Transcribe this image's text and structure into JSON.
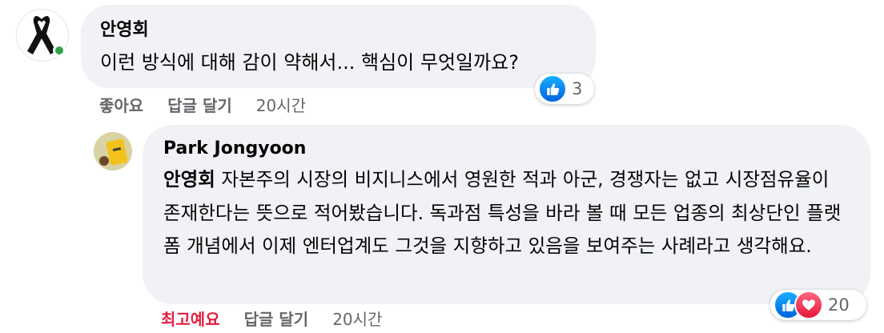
{
  "comment": {
    "author": "안영회",
    "text": "이런 방식에 대해 감이 약해서... 핵심이 무엇일까요?",
    "reactions": {
      "count": "3",
      "icons": [
        "like-icon"
      ]
    },
    "actions": {
      "like": "좋아요",
      "reply": "답글 달기",
      "time": "20시간"
    }
  },
  "reply": {
    "author": "Park Jongyoon",
    "mention": "안영회",
    "text": " 자본주의 시장의 비지니스에서 영원한 적과 아군, 경쟁자는 없고 시장점유율이 존재한다는 뜻으로 적어봤습니다. 독과점 특성을 바라 볼 때 모든 업종의 최상단인 플랫폼 개념에서 이제 엔터업계도 그것을 지향하고 있음을 보여주는 사례라고 생각해요.",
    "reactions": {
      "count": "20",
      "icons": [
        "like-icon",
        "love-icon"
      ]
    },
    "actions": {
      "like": "최고예요",
      "reply": "답글 달기",
      "time": "20시간"
    }
  },
  "colors": {
    "bubble": "#f0f2f5",
    "meta": "#65676b",
    "love": "#e41e3f",
    "online": "#31a24c"
  }
}
